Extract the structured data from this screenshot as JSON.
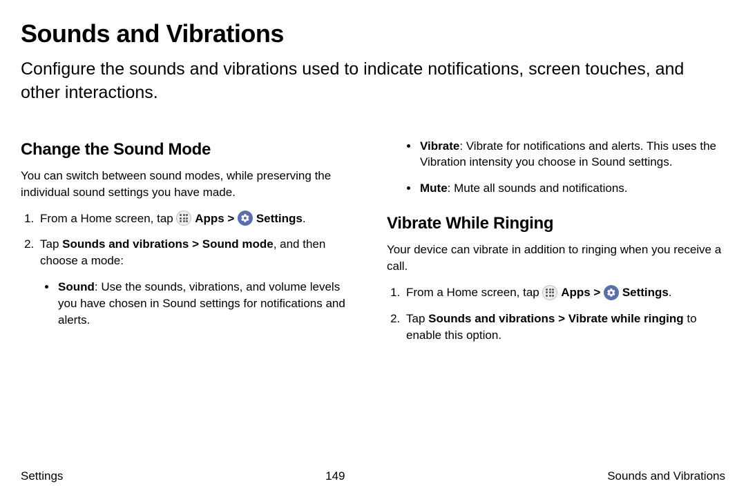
{
  "title": "Sounds and Vibrations",
  "intro": "Configure the sounds and vibrations used to indicate notifications, screen touches, and other interactions.",
  "section1": {
    "heading": "Change the Sound Mode",
    "desc": "You can switch between sound modes, while preserving the individual sound settings you have made.",
    "step1_pre": "From a Home screen, tap ",
    "apps": "Apps",
    "gt": " > ",
    "settings": "Settings",
    "period": ".",
    "step2_pre": "Tap ",
    "step2_bold": "Sounds and vibrations > Sound mode",
    "step2_post": ", and then choose a mode:",
    "sound_label": "Sound",
    "sound_text": ": Use the sounds, vibrations, and volume levels you have chosen in Sound settings for notifications and alerts."
  },
  "section2": {
    "vibrate_label": "Vibrate",
    "vibrate_text": ": Vibrate for notifications and alerts. This uses the Vibration intensity you choose in Sound settings.",
    "mute_label": "Mute",
    "mute_text": ": Mute all sounds and notifications.",
    "heading": "Vibrate While Ringing",
    "desc": "Your device can vibrate in addition to ringing when you receive a call.",
    "step1_pre": "From a Home screen, tap ",
    "apps": "Apps",
    "gt": " > ",
    "settings": "Settings",
    "period": ".",
    "step2_pre": "Tap ",
    "step2_bold": "Sounds and vibrations > Vibrate while ringing",
    "step2_post": " to enable this option."
  },
  "footer": {
    "left": "Settings",
    "center": "149",
    "right": "Sounds and Vibrations"
  }
}
